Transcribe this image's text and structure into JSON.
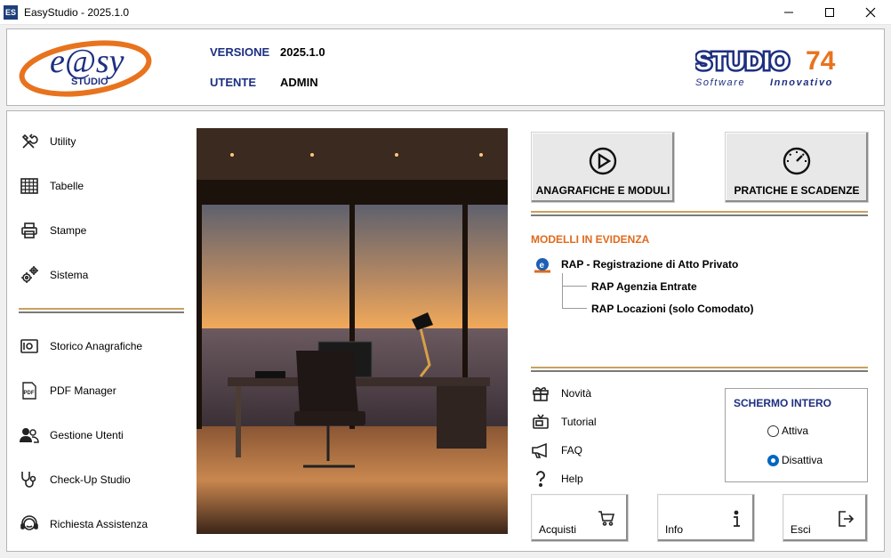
{
  "window": {
    "title": "EasyStudio - 2025.1.0",
    "icon_text": "ES",
    "buttons": [
      "minimize-icon",
      "maximize-icon",
      "close-icon"
    ]
  },
  "header": {
    "logo_text": "e@sy",
    "logo_subtext": "STUDIO",
    "version_label": "VERSIONE",
    "version_value": "2025.1.0",
    "user_label": "UTENTE",
    "user_value": "ADMIN",
    "brand_text": "STUDIO",
    "brand_number": "74",
    "brand_tagline_1": "Software",
    "brand_tagline_2": "Innovativo"
  },
  "sidebar": {
    "group1": [
      {
        "label": "Utility",
        "icon": "tools-icon"
      },
      {
        "label": "Tabelle",
        "icon": "table-icon"
      },
      {
        "label": "Stampe",
        "icon": "printer-icon"
      },
      {
        "label": "Sistema",
        "icon": "gears-icon"
      }
    ],
    "group2": [
      {
        "label": "Storico Anagrafiche",
        "icon": "archive-icon"
      },
      {
        "label": "PDF Manager",
        "icon": "pdf-icon"
      },
      {
        "label": "Gestione Utenti",
        "icon": "users-icon"
      },
      {
        "label": "Check-Up Studio",
        "icon": "stethoscope-icon"
      },
      {
        "label": "Richiesta Assistenza",
        "icon": "headset-icon"
      }
    ]
  },
  "actions": {
    "anagrafiche": "ANAGRAFICHE E MODULI",
    "pratiche": "PRATICHE E SCADENZE"
  },
  "models": {
    "section_title": "MODELLI IN EVIDENZA",
    "root": "RAP - Registrazione di Atto Privato",
    "children": [
      "RAP Agenzia Entrate",
      "RAP Locazioni (solo Comodato)"
    ]
  },
  "links": [
    {
      "label": "Novità",
      "icon": "gift-icon"
    },
    {
      "label": "Tutorial",
      "icon": "tv-icon"
    },
    {
      "label": "FAQ",
      "icon": "megaphone-icon"
    },
    {
      "label": "Help",
      "icon": "question-icon"
    }
  ],
  "fullscreen": {
    "title": "SCHERMO INTERO",
    "options": [
      "Attiva",
      "Disattiva"
    ],
    "selected": "Disattiva"
  },
  "bottom_buttons": {
    "acquisti": "Acquisti",
    "info": "Info",
    "esci": "Esci"
  },
  "colors": {
    "accent_orange": "#e06a1b",
    "brand_blue": "#1d2f80",
    "divider_gold": "#caa15e"
  }
}
